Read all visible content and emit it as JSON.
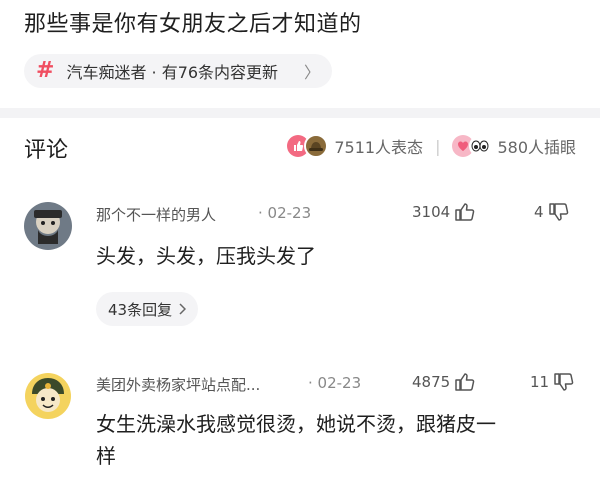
{
  "post": {
    "title": "那些事是你有女朋友之后才知道的",
    "topic_hash": "#",
    "topic_text": "汽车痴迷者 · 有76条内容更新",
    "topic_chevron": "〉"
  },
  "comments_section": {
    "title": "评论",
    "reaction_summary": "7511人表态",
    "separator": "|",
    "peek_summary": "580人插眼"
  },
  "comments": [
    {
      "author": "那个不一样的男人",
      "date": "· 02-23",
      "likes": "3104",
      "dislikes": "4",
      "text": "头发，头发，压我头发了",
      "replies": "43条回复"
    },
    {
      "author": "美团外卖杨家坪站点配...",
      "date": "· 02-23",
      "likes": "4875",
      "dislikes": "11",
      "text_line1": "女生洗澡水我感觉很烫，她说不烫，跟猪皮一",
      "text_line2": "样"
    }
  ],
  "colors": {
    "accent": "#f04e61",
    "chip_bg": "#f4f4f6",
    "divider": "#f3f3f5"
  }
}
